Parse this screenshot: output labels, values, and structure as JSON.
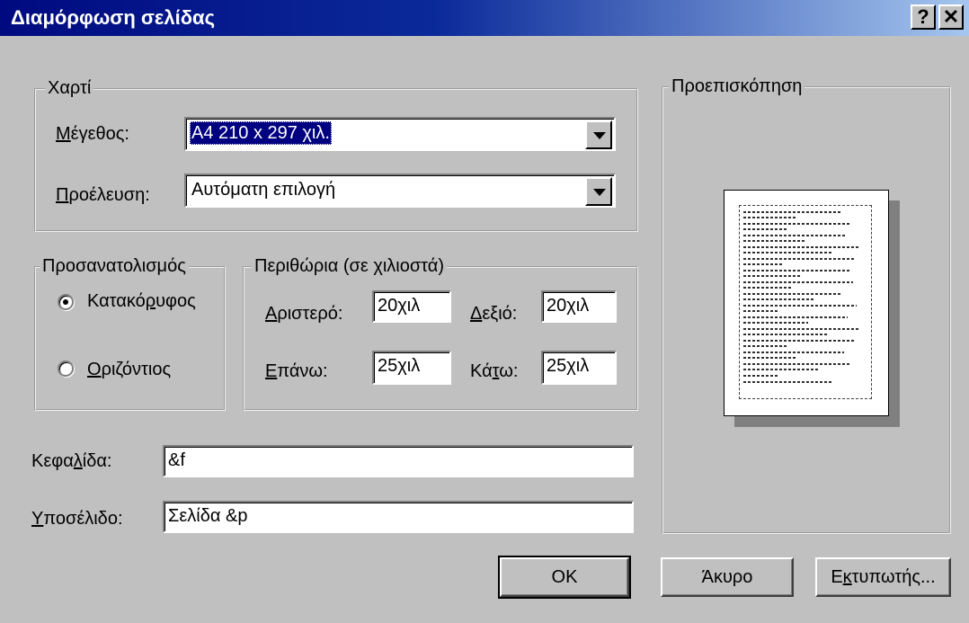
{
  "window": {
    "title": "Διαμόρφωση σελίδας",
    "help_label": "?",
    "close_label": "✕"
  },
  "paper": {
    "legend": "Χαρτί",
    "size_label_u": "Μ",
    "size_label_rest": "έγεθος:",
    "size_value": "A4 210 x 297 χιλ.",
    "source_label_u": "Π",
    "source_label_rest": "ροέλευση:",
    "source_value": "Αυτόματη επιλογή"
  },
  "orientation": {
    "legend": "Προσανατολισμός",
    "portrait_pre": "Κατακό",
    "portrait_u": "ρ",
    "portrait_post": "υφος",
    "landscape_u": "Ο",
    "landscape_rest": "ριζόντιος",
    "selected": "portrait"
  },
  "margins": {
    "legend": "Περιθώρια (σε χιλιοστά)",
    "left_u": "Α",
    "left_rest": "ριστερό:",
    "left_value": "20χιλ",
    "right_u": "Δ",
    "right_rest": "εξιό:",
    "right_value": "20χιλ",
    "top_u": "Ε",
    "top_rest": "πάνω:",
    "top_value": "25χιλ",
    "bottom_pre": "Κά",
    "bottom_u": "τ",
    "bottom_post": "ω:",
    "bottom_value": "25χιλ"
  },
  "header": {
    "label_pre": "Κεφα",
    "label_u": "λ",
    "label_post": "ίδα:",
    "value": "&f"
  },
  "footer": {
    "label_u": "Υ",
    "label_rest": "ποσέλιδο:",
    "value": "Σελίδα &p"
  },
  "preview": {
    "legend": "Προεπισκόπηση"
  },
  "buttons": {
    "ok": "OK",
    "cancel": "Άκυρο",
    "printer_pre": "Ε",
    "printer_u": "κ",
    "printer_post": "τυπωτής..."
  }
}
